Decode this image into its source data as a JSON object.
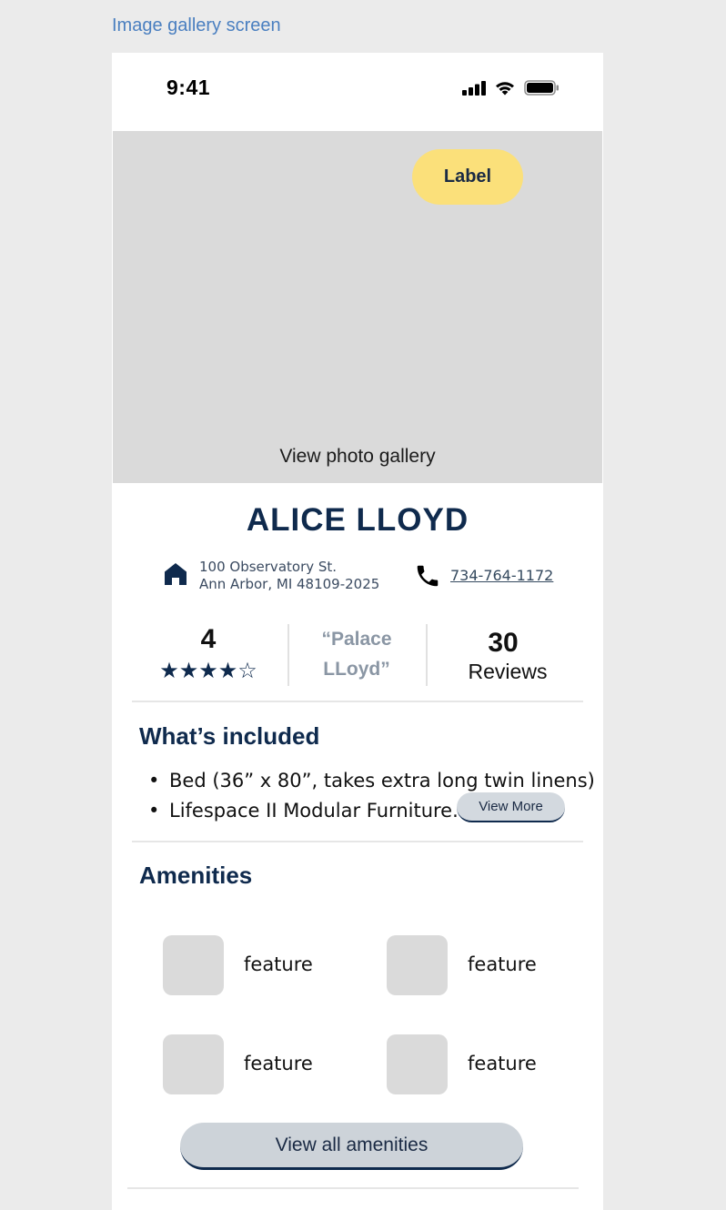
{
  "frame_title": "Image gallery screen",
  "status_bar": {
    "time": "9:41",
    "icons": [
      "cellular-signal-icon",
      "wifi-icon",
      "battery-icon"
    ]
  },
  "hero": {
    "badge_label": "Label",
    "gallery_link": "View photo gallery",
    "placeholder_color": "#dadada",
    "badge_color": "#fbe07a"
  },
  "residence": {
    "name": "ALICE LLOYD",
    "address_line1": "100 Observatory St.",
    "address_line2": "Ann Arbor, MI 48109-2025",
    "phone": "734-764-1172"
  },
  "stats": {
    "rating_value": "4",
    "rating_stars": "★★★★☆",
    "rating_out_of_5": 4,
    "nickname_line1": "“Palace",
    "nickname_line2": "LLoyd”",
    "reviews_count": "30",
    "reviews_label": "Reviews"
  },
  "included": {
    "title": "What’s included",
    "items": [
      "Bed (36” x 80”, takes extra long twin linens)",
      "Lifespace II Modular Furniture.."
    ],
    "view_more_label": "View More"
  },
  "amenities": {
    "title": "Amenities",
    "items": [
      {
        "label": "feature"
      },
      {
        "label": "feature"
      },
      {
        "label": "feature"
      },
      {
        "label": "feature"
      }
    ],
    "view_all_label": "View all amenities"
  },
  "colors": {
    "brand_navy": "#0f2a4d",
    "background": "#ebebeb",
    "button_gray": "#cdd3d9"
  }
}
